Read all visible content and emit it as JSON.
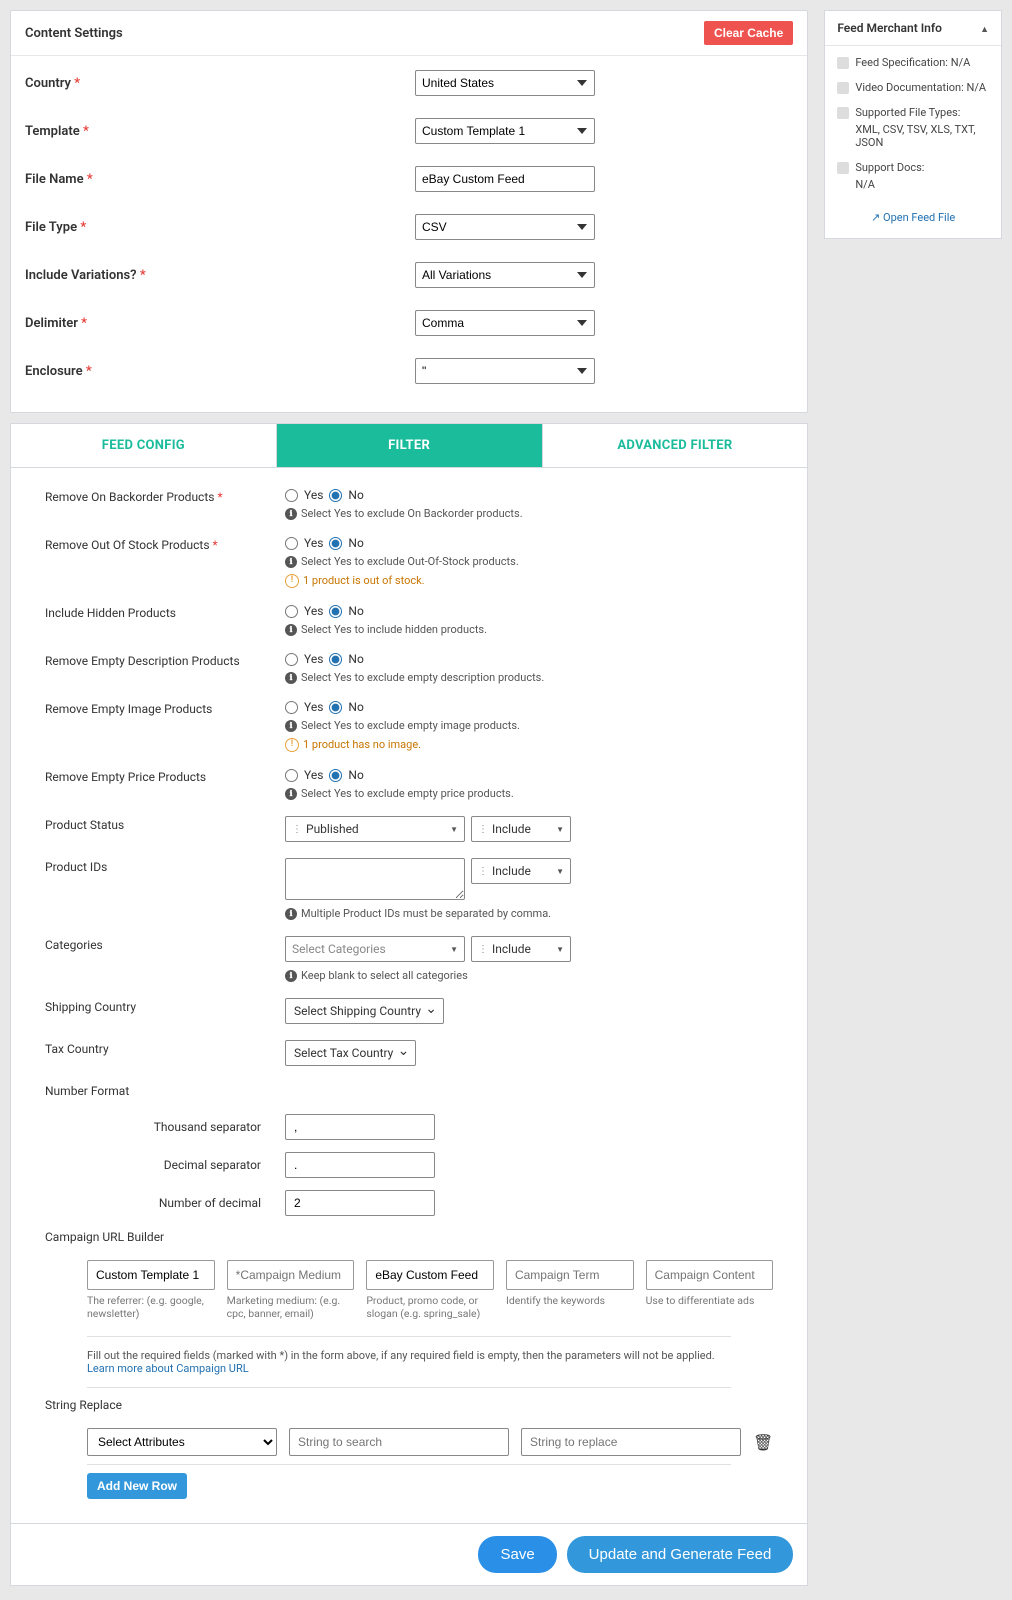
{
  "content": {
    "title": "Content Settings",
    "clear": "Clear Cache",
    "rows": {
      "country": {
        "label": "Country",
        "value": "United States"
      },
      "template": {
        "label": "Template",
        "value": "Custom Template 1"
      },
      "filename": {
        "label": "File Name",
        "value": "eBay Custom Feed"
      },
      "filetype": {
        "label": "File Type",
        "value": "CSV"
      },
      "variations": {
        "label": "Include Variations?",
        "value": "All Variations"
      },
      "delimiter": {
        "label": "Delimiter",
        "value": "Comma"
      },
      "enclosure": {
        "label": "Enclosure",
        "value": "\""
      }
    }
  },
  "tabs": {
    "feed": "FEED CONFIG",
    "filter": "FILTER",
    "advanced": "ADVANCED FILTER"
  },
  "filters": {
    "yes": "Yes",
    "no": "No",
    "backorder": {
      "label": "Remove On Backorder Products",
      "hint": "Select Yes to exclude On Backorder products."
    },
    "outofstock": {
      "label": "Remove Out Of Stock Products",
      "hint": "Select Yes to exclude Out-Of-Stock products.",
      "warn": "1 product is out of stock."
    },
    "hidden": {
      "label": "Include Hidden Products",
      "hint": "Select Yes to include hidden products."
    },
    "emptydesc": {
      "label": "Remove Empty Description Products",
      "hint": "Select Yes to exclude empty description products."
    },
    "emptyimg": {
      "label": "Remove Empty Image Products",
      "hint": "Select Yes to exclude empty image products.",
      "warn": "1 product has no image."
    },
    "emptyprice": {
      "label": "Remove Empty Price Products",
      "hint": "Select Yes to exclude empty price products."
    },
    "status": {
      "label": "Product Status",
      "value": "Published",
      "inc": "Include"
    },
    "ids": {
      "label": "Product IDs",
      "hint": "Multiple Product IDs must be separated by comma.",
      "inc": "Include"
    },
    "cats": {
      "label": "Categories",
      "placeholder": "Select Categories",
      "hint": "Keep blank to select all categories",
      "inc": "Include"
    },
    "ship": {
      "label": "Shipping Country",
      "placeholder": "Select Shipping Country"
    },
    "tax": {
      "label": "Tax Country",
      "placeholder": "Select Tax Country"
    }
  },
  "numfmt": {
    "title": "Number Format",
    "thousand": {
      "label": "Thousand separator",
      "value": ","
    },
    "decimal": {
      "label": "Decimal separator",
      "value": "."
    },
    "decimals": {
      "label": "Number of decimal",
      "value": "2"
    }
  },
  "campaign": {
    "title": "Campaign URL Builder",
    "source": {
      "value": "Custom Template 1",
      "hint": "The referrer: (e.g. google, newsletter)"
    },
    "medium": {
      "placeholder": "*Campaign Medium",
      "hint": "Marketing medium: (e.g. cpc, banner, email)"
    },
    "name": {
      "value": "eBay Custom Feed",
      "hint": "Product, promo code, or slogan (e.g. spring_sale)"
    },
    "term": {
      "placeholder": "Campaign Term",
      "hint": "Identify the keywords"
    },
    "content": {
      "placeholder": "Campaign Content",
      "hint": "Use to differentiate ads"
    },
    "note1": "Fill out the required fields (marked with *) in the form above, if any required field is empty, then the parameters will not be applied. ",
    "note2": "Learn more about Campaign URL"
  },
  "sr": {
    "title": "String Replace",
    "select": "Select Attributes",
    "search": "String to search",
    "replace": "String to replace",
    "add": "Add New Row"
  },
  "buttons": {
    "save": "Save",
    "generate": "Update and Generate Feed"
  },
  "side": {
    "title": "Feed Merchant Info",
    "spec": {
      "label": "Feed Specification:",
      "value": "N/A"
    },
    "video": {
      "label": "Video Documentation:",
      "value": "N/A"
    },
    "filetypes": {
      "label": "Supported File Types:",
      "value": "XML, CSV, TSV, XLS, TXT, JSON"
    },
    "support": {
      "label": "Support Docs:",
      "value": "N/A"
    },
    "open": "Open Feed File"
  }
}
